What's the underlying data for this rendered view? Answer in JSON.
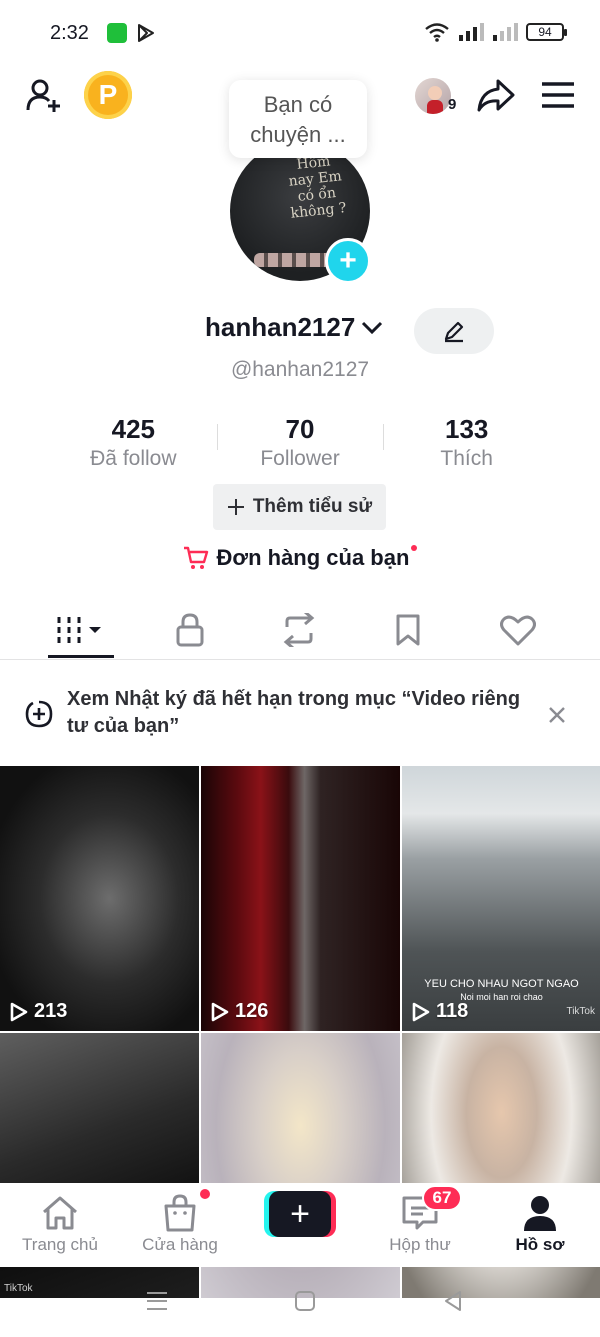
{
  "status_bar": {
    "time": "2:32",
    "battery": "94"
  },
  "top_bar": {
    "coin_letter": "P",
    "friends_count": "9"
  },
  "bubble": {
    "text": "Bạn có chuyện ..."
  },
  "avatar_text": "Hôm nay Em có ổn không ?",
  "profile": {
    "username": "hanhan2127",
    "handle": "@hanhan2127",
    "stats": [
      {
        "value": "425",
        "label": "Đã follow"
      },
      {
        "value": "70",
        "label": "Follower"
      },
      {
        "value": "133",
        "label": "Thích"
      }
    ],
    "add_bio_label": "Thêm tiểu sử",
    "orders_label": "Đơn hàng của bạn"
  },
  "notice": {
    "text": "Xem Nhật ký đã hết hạn trong mục “Video riêng tư của bạn”"
  },
  "videos": [
    {
      "views": "213"
    },
    {
      "views": "126"
    },
    {
      "views": "118",
      "caption": "YEU CHO NHAU NGOT NGAO",
      "subcaption": "Noi moi han roi chao",
      "watermark": "TikTok"
    },
    {
      "views": "",
      "watermark": "TikTok"
    },
    {
      "views": ""
    },
    {
      "views": ""
    }
  ],
  "bottom_nav": {
    "home": "Trang chủ",
    "shop": "Cửa hàng",
    "inbox": "Hộp thư",
    "inbox_badge": "67",
    "profile": "Hồ sơ"
  },
  "colors": {
    "accent": "#fe2c55",
    "cyan": "#25f4ee",
    "text": "#161823",
    "muted": "#8a8b91"
  }
}
